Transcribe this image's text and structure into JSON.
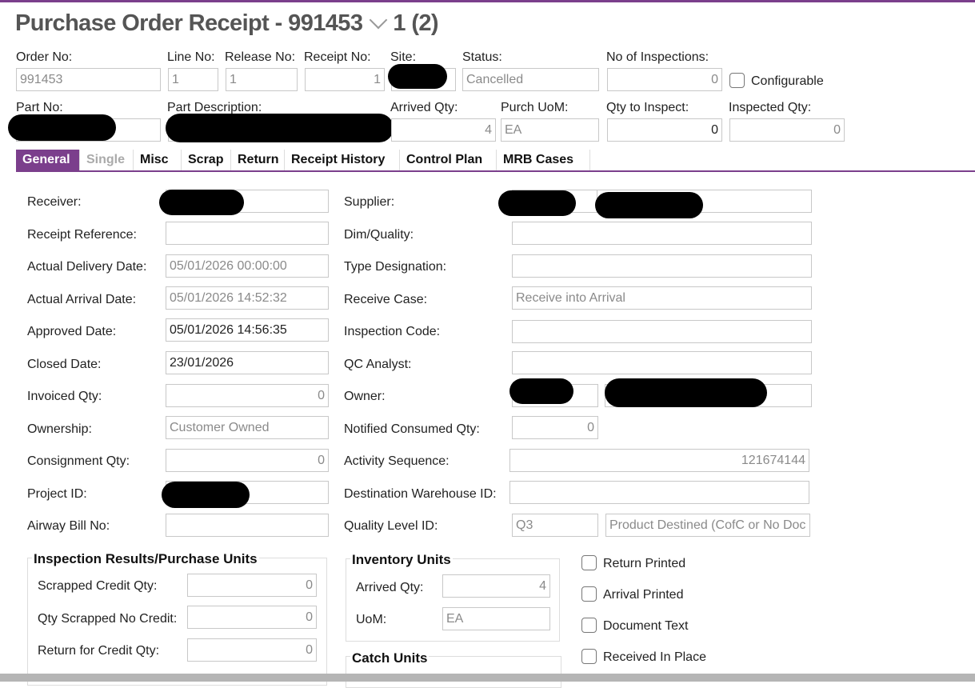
{
  "header": {
    "title_prefix": "Purchase Order Receipt - 991453",
    "title_suffix": "1 (2)"
  },
  "top": {
    "order_no_label": "Order No:",
    "order_no": "991453",
    "line_no_label": "Line No:",
    "line_no": "1",
    "release_no_label": "Release No:",
    "release_no": "1",
    "receipt_no_label": "Receipt No:",
    "receipt_no": "1",
    "site_label": "Site:",
    "status_label": "Status:",
    "status": "Cancelled",
    "no_inspections_label": "No of Inspections:",
    "no_inspections": "0",
    "configurable_label": "Configurable",
    "part_no_label": "Part No:",
    "part_desc_label": "Part Description:",
    "arrived_qty_label": "Arrived Qty:",
    "arrived_qty": "4",
    "purch_uom_label": "Purch UoM:",
    "purch_uom": "EA",
    "qty_to_inspect_label": "Qty to Inspect:",
    "qty_to_inspect": "0",
    "inspected_qty_label": "Inspected Qty:",
    "inspected_qty": "0"
  },
  "tabs": [
    "General",
    "Single",
    "Misc",
    "Scrap",
    "Return",
    "Receipt History",
    "Control Plan",
    "MRB Cases"
  ],
  "left": {
    "receiver_label": "Receiver:",
    "receipt_ref_label": "Receipt Reference:",
    "actual_delivery_label": "Actual Delivery Date:",
    "actual_delivery": "05/01/2026 00:00:00",
    "actual_arrival_label": "Actual Arrival Date:",
    "actual_arrival": "05/01/2026 14:52:32",
    "approved_label": "Approved Date:",
    "approved": "05/01/2026 14:56:35",
    "closed_label": "Closed Date:",
    "closed": "23/01/2026",
    "invoiced_label": "Invoiced Qty:",
    "invoiced": "0",
    "ownership_label": "Ownership:",
    "ownership": "Customer Owned",
    "consignment_label": "Consignment Qty:",
    "consignment": "0",
    "project_label": "Project ID:",
    "airway_label": "Airway Bill No:"
  },
  "right": {
    "supplier_label": "Supplier:",
    "dim_label": "Dim/Quality:",
    "type_label": "Type Designation:",
    "receive_case_label": "Receive Case:",
    "receive_case": "Receive into Arrival",
    "inspection_code_label": "Inspection Code:",
    "qc_label": "QC Analyst:",
    "owner_label": "Owner:",
    "notified_label": "Notified Consumed Qty:",
    "notified": "0",
    "activity_label": "Activity Sequence:",
    "activity": "121674144",
    "dest_label": "Destination Warehouse ID:",
    "quality_label": "Quality Level ID:",
    "quality_id": "Q3",
    "quality_desc": "Product Destined (CofC or No Doc"
  },
  "inspection": {
    "title": "Inspection Results/Purchase Units",
    "scrapped_credit_label": "Scrapped Credit Qty:",
    "scrapped_credit": "0",
    "scrapped_no_credit_label": "Qty Scrapped No Credit:",
    "scrapped_no_credit": "0",
    "return_credit_label": "Return for Credit Qty:",
    "return_credit": "0"
  },
  "inventory": {
    "title": "Inventory Units",
    "arrived_label": "Arrived Qty:",
    "arrived": "4",
    "uom_label": "UoM:",
    "uom": "EA"
  },
  "catch": {
    "title": "Catch Units"
  },
  "checks": {
    "return_printed": "Return Printed",
    "arrival_printed": "Arrival Printed",
    "document_text": "Document Text",
    "received_in_place": "Received In Place"
  },
  "colors": {
    "accent": "#7b3f8c"
  }
}
